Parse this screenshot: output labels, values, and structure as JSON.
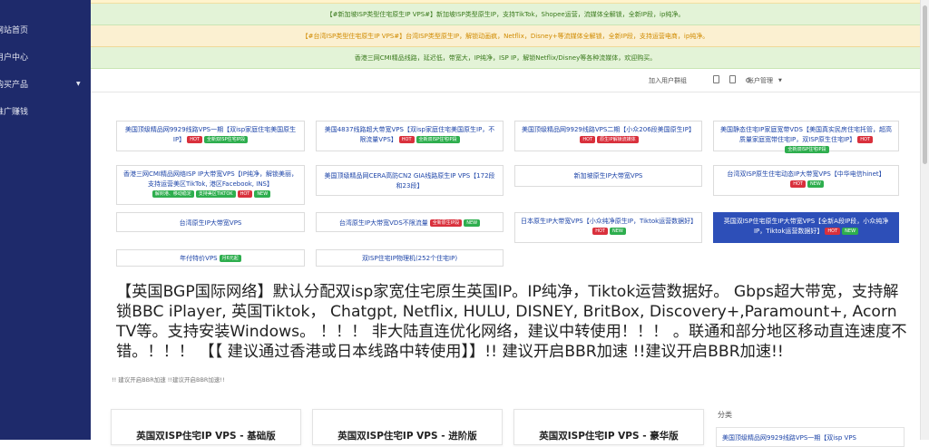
{
  "sidebar": {
    "items": [
      {
        "label": "网站首页"
      },
      {
        "label": "用户中心"
      },
      {
        "label": "购买产品"
      },
      {
        "label": "推广赚钱"
      }
    ]
  },
  "notices": [
    {
      "text": "【#新加坡ISP类型住宅原生IP VPS#】新加坡ISP类型原生IP，支持TikTok，Shopee运营，流媒体全解锁，全新IP段，ip纯净。"
    },
    {
      "text": "【#台湾ISP类型住宅原生IP VPS#】台湾ISP类型原生IP，解锁动画疯，Netflix，Disney+等流媒体全解锁，全新IP段，支持运营电商，ip纯净。"
    },
    {
      "text": "香港三网CMI精品线路，延迟低，带宽大，IP纯净，ISP IP，解锁Netflix/Disney等各种流媒体，欢迎购买。"
    }
  ],
  "topbar": {
    "join_group": "加入用户群组",
    "account_menu": "账户管理"
  },
  "products": [
    {
      "label": "美国顶级精品网9929线路VPS一期【双isp家庭住宅美国原生IP】",
      "badges": [
        "HOT",
        "全新双ISP住宅IP段"
      ]
    },
    {
      "label": "美国4837线路超大带宽VPS【双isp家庭住宅美国原生IP，不限流量VPS】",
      "badges": [
        "HOT",
        "全新双ISP住宅IP段"
      ]
    },
    {
      "label": "美国顶级精品网9929线路VPS二期【小众206段美国原生IP】",
      "badges": [
        "HOT",
        "原生IP解锁流媒体"
      ]
    },
    {
      "label": "美国静态住宅IP家庭宽带VDS【美国真实民房住宅托管，超高质量家庭宽带住宅IP，双ISP原生住宅IP】",
      "badges": [
        "HOT",
        "全新双ISP住宅IP段"
      ]
    },
    {
      "label": "香港三网CMI精品网络ISP IP大带宽VPS【IP纯净，解锁美丽，支持运营美区TikTok, 港区Facebook, INS】",
      "badges": [
        "解封港、移动稳定",
        "支持美区TIKTOK",
        "HOT",
        "NEW"
      ]
    },
    {
      "label": "美国顶级精品网CERA高防CN2 GIA线路原生IP VPS【172段和23段】",
      "badges": []
    },
    {
      "label": "新加坡原生IP大带宽VPS",
      "badges": []
    },
    {
      "label": "台湾双ISP原生住宅动态IP大带宽VPS【中华电信hinet】",
      "badges": [
        "HOT",
        "NEW"
      ]
    },
    {
      "label": "台湾原生IP大带宽VPS",
      "badges": []
    },
    {
      "label": "台湾原生IP大带宽VDS不限流量",
      "badges": [
        "全新原生IP段",
        "NEW"
      ]
    },
    {
      "label": "日本原生IP大带宽VPS【小众纯净原生IP，Tiktok运营数据好】",
      "badges": [
        "HOT",
        "NEW"
      ]
    },
    {
      "label": "英国双ISP住宅原生IP大带宽VPS【全新A段IP段，小众纯净IP，Tiktok运营数据好】",
      "badges": [
        "HOT",
        "NEW"
      ]
    },
    {
      "label": "年付特价VPS",
      "badges": [
        "月6元起"
      ]
    },
    {
      "label": "双ISP住宅IP物理机(252个住宅IP)",
      "badges": []
    }
  ],
  "description": "【英国BGP国际网络】默认分配双isp家宽住宅原生英国IP。IP纯净，Tiktok运营数据好。 Gbps超大带宽，支持解锁BBC iPlayer, 英国Tiktok， Chatgpt, Netflix, HULU, DISNEY, BritBox, Discovery+,Paramount+, Acorn TV等。支持安装Windows。 ！！！ 非大陆直连优化网络，建议中转使用！！！ 。联通和部分地区移动直连速度不错。！！！ 【【 建议通过香港或日本线路中转使用】】!! 建议开启BBR加速 !!建议开启BBR加速!!",
  "description_sub": "!! 建议开启BBR加速 !!建议开启BBR加速!!",
  "plans": [
    {
      "title": "英国双ISP住宅IP VPS - 基础版"
    },
    {
      "title": "英国双ISP住宅IP VPS - 进阶版"
    },
    {
      "title": "英国双ISP住宅IP VPS - 豪华版"
    }
  ],
  "categories": {
    "title": "分类",
    "first_item": "美国顶级精品网9929线路VPS一期【双isp VPS"
  },
  "colors": {
    "sidebar": "#1e2a6b",
    "link": "#1e45a8",
    "active": "#2d4fb8",
    "hot": "#d9303c",
    "new": "#2eae4e"
  }
}
